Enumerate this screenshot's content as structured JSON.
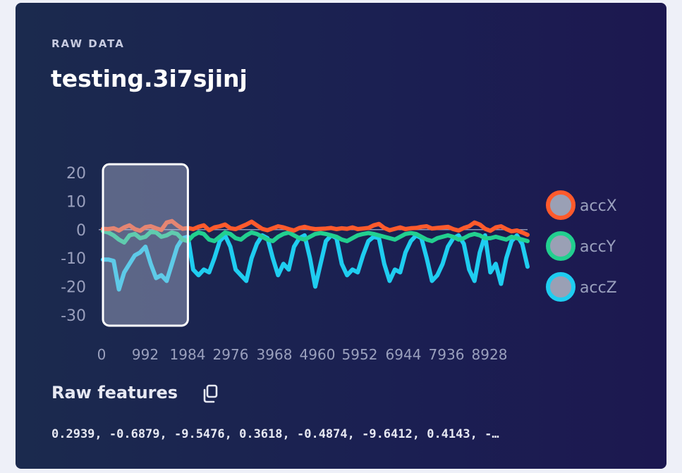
{
  "card": {
    "overline": "RAW DATA",
    "title": "testing.3i7sjinj"
  },
  "features": {
    "title": "Raw features",
    "copy_icon": "copy-icon",
    "values_text": "0.2939, -0.6879, -9.5476, 0.3618, -0.4874, -9.6412, 0.4143, -…"
  },
  "chart_data": {
    "type": "line",
    "x": [
      0,
      124,
      248,
      372,
      496,
      620,
      744,
      868,
      992,
      1116,
      1240,
      1364,
      1488,
      1612,
      1736,
      1860,
      1984,
      2108,
      2232,
      2356,
      2480,
      2604,
      2728,
      2852,
      2976,
      3100,
      3224,
      3348,
      3472,
      3596,
      3720,
      3844,
      3968,
      4092,
      4216,
      4340,
      4464,
      4588,
      4712,
      4836,
      4960,
      5084,
      5208,
      5332,
      5456,
      5580,
      5704,
      5828,
      5952,
      6076,
      6200,
      6324,
      6448,
      6572,
      6696,
      6820,
      6944,
      7068,
      7192,
      7316,
      7440,
      7564,
      7688,
      7812,
      7936,
      8060,
      8184,
      8308,
      8432,
      8556,
      8680,
      8804,
      8928,
      9052,
      9176,
      9300,
      9424,
      9548,
      9672,
      9796,
      9920
    ],
    "xlim": [
      0,
      9920
    ],
    "ylim": [
      -30,
      20
    ],
    "x_ticks": [
      "0",
      "992",
      "1984",
      "2976",
      "3968",
      "4960",
      "5952",
      "6944",
      "7936",
      "8928"
    ],
    "y_ticks": [
      "20",
      "10",
      "0",
      "-10",
      "-20",
      "-30"
    ],
    "legend_position": "right",
    "highlight_window": [
      0,
      1984
    ],
    "series": [
      {
        "name": "accX",
        "color": "#ff5a2c",
        "values": [
          0.3,
          0.2,
          0.5,
          -0.3,
          0.8,
          1.5,
          0.2,
          -0.4,
          0.9,
          1.2,
          0.5,
          -0.1,
          2.5,
          3.0,
          1.5,
          0.3,
          0.6,
          0.2,
          1.0,
          1.5,
          -0.2,
          0.8,
          1.2,
          1.8,
          0.5,
          0.2,
          1.0,
          1.8,
          2.8,
          1.5,
          0.3,
          -0.2,
          0.5,
          1.2,
          0.8,
          0.2,
          -0.3,
          0.6,
          1.0,
          0.5,
          0.2,
          0.3,
          0.4,
          0.6,
          0.2,
          0.5,
          0.3,
          0.8,
          0.2,
          0.4,
          0.6,
          1.5,
          2.0,
          0.6,
          -0.2,
          0.3,
          0.8,
          0.2,
          0.5,
          0.6,
          1.0,
          1.2,
          0.4,
          0.6,
          0.8,
          1.0,
          0.2,
          -0.3,
          0.6,
          1.2,
          2.5,
          1.8,
          0.3,
          -0.4,
          0.8,
          1.2,
          0.2,
          -0.6,
          -0.3,
          -1.0,
          -1.8
        ]
      },
      {
        "name": "accY",
        "color": "#22cf8f",
        "values": [
          -0.5,
          -1.0,
          -2.0,
          -3.5,
          -4.5,
          -2.0,
          -1.5,
          -3.0,
          -2.5,
          -0.8,
          -1.0,
          -2.5,
          -2.0,
          -1.0,
          -1.5,
          -3.5,
          -4.0,
          -2.0,
          -1.0,
          -1.5,
          -3.5,
          -4.0,
          -2.5,
          -1.0,
          -1.5,
          -3.0,
          -3.5,
          -2.0,
          -1.0,
          -1.5,
          -2.5,
          -3.5,
          -4.0,
          -2.5,
          -1.5,
          -1.0,
          -2.0,
          -3.0,
          -3.5,
          -2.5,
          -1.5,
          -1.2,
          -1.5,
          -2.0,
          -2.5,
          -3.5,
          -4.0,
          -3.0,
          -2.0,
          -1.5,
          -1.2,
          -1.5,
          -2.0,
          -2.5,
          -3.0,
          -3.5,
          -2.5,
          -1.5,
          -1.2,
          -1.5,
          -2.5,
          -3.5,
          -4.0,
          -3.0,
          -2.5,
          -2.0,
          -2.5,
          -3.5,
          -3.0,
          -2.0,
          -1.5,
          -2.0,
          -3.0,
          -3.0,
          -2.5,
          -3.0,
          -3.5,
          -2.5,
          -3.0,
          -3.5,
          -4.0
        ]
      },
      {
        "name": "accZ",
        "color": "#1fcdf0",
        "values": [
          -10.5,
          -10.5,
          -11.0,
          -21.0,
          -15.0,
          -12.0,
          -9.0,
          -8.0,
          -6.0,
          -12.0,
          -17.0,
          -16.0,
          -18.0,
          -12.0,
          -6.0,
          -3.0,
          -2.5,
          -14.0,
          -16.0,
          -14.0,
          -15.0,
          -10.0,
          -4.0,
          -2.0,
          -6.0,
          -14.0,
          -16.0,
          -18.0,
          -10.0,
          -5.0,
          -2.0,
          -3.0,
          -10.0,
          -16.0,
          -12.0,
          -14.0,
          -6.0,
          -3.0,
          -2.0,
          -10.0,
          -20.0,
          -12.0,
          -4.0,
          -2.0,
          -3.0,
          -12.0,
          -16.0,
          -14.0,
          -15.0,
          -9.0,
          -4.0,
          -2.5,
          -3.0,
          -12.0,
          -18.0,
          -14.0,
          -15.0,
          -8.0,
          -4.0,
          -2.0,
          -3.0,
          -10.0,
          -18.0,
          -16.0,
          -12.0,
          -6.0,
          -3.0,
          -2.0,
          -5.0,
          -14.0,
          -18.0,
          -8.0,
          -2.0,
          -15.0,
          -12.0,
          -19.0,
          -10.0,
          -4.0,
          -2.0,
          -5.0,
          -13.0
        ]
      }
    ]
  }
}
